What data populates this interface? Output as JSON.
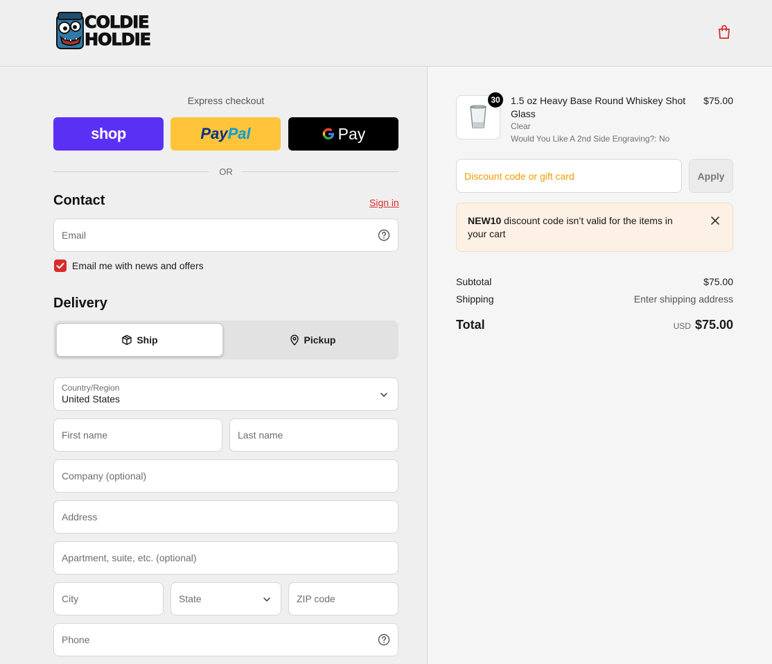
{
  "header": {
    "logo_line1": "COLDIE",
    "logo_line2": "HOLDIE",
    "cart_icon": "shopping-bag-icon"
  },
  "express": {
    "title": "Express checkout",
    "shop_label": "shop",
    "paypal_part1": "Pay",
    "paypal_part2": "Pal",
    "gpay_label": "Pay",
    "or_label": "OR"
  },
  "contact": {
    "heading": "Contact",
    "signin_label": "Sign in",
    "email_placeholder": "Email",
    "newsletter_label": "Email me with news and offers"
  },
  "delivery": {
    "heading": "Delivery",
    "ship_label": "Ship",
    "pickup_label": "Pickup",
    "country_label": "Country/Region",
    "country_value": "United States",
    "first_name": "First name",
    "last_name": "Last name",
    "company": "Company (optional)",
    "address": "Address",
    "apartment": "Apartment, suite, etc. (optional)",
    "city": "City",
    "state": "State",
    "zip": "ZIP code",
    "phone": "Phone"
  },
  "order": {
    "quantity": "30",
    "product_name": "1.5 oz Heavy Base Round Whiskey Shot Glass",
    "variant": "Clear",
    "engraving": "Would You Like A 2nd Side Engraving?: No",
    "price": "$75.00",
    "discount_placeholder": "Discount code or gift card",
    "apply_label": "Apply",
    "warning_code": "NEW10",
    "warning_text": " discount code isn’t valid for the items in your cart",
    "subtotal_label": "Subtotal",
    "subtotal_value": "$75.00",
    "shipping_label": "Shipping",
    "shipping_value": "Enter shipping address",
    "total_label": "Total",
    "currency": "USD",
    "total_value": "$75.00"
  },
  "colors": {
    "accent": "#d82c2c",
    "shop_pay": "#5a31f4",
    "paypal": "#ffc439",
    "discount_text": "#f29b00"
  }
}
